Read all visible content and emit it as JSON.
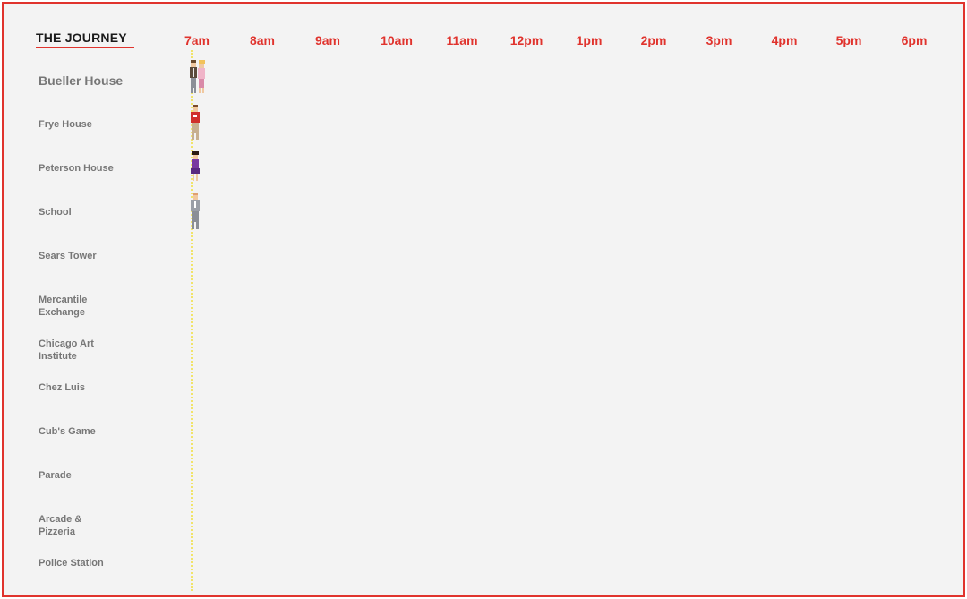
{
  "title": "THE JOURNEY",
  "hours": [
    "7am",
    "8am",
    "9am",
    "10am",
    "11am",
    "12pm",
    "1pm",
    "2pm",
    "3pm",
    "4pm",
    "5pm",
    "6pm"
  ],
  "places": [
    {
      "line1": "Bueller House",
      "line2": ""
    },
    {
      "line1": "Frye House",
      "line2": ""
    },
    {
      "line1": "Peterson House",
      "line2": ""
    },
    {
      "line1": "School",
      "line2": ""
    },
    {
      "line1": "Sears Tower",
      "line2": ""
    },
    {
      "line1": "Mercantile",
      "line2": "Exchange"
    },
    {
      "line1": "Chicago Art",
      "line2": "Institute"
    },
    {
      "line1": "Chez Luis",
      "line2": ""
    },
    {
      "line1": "Cub's Game",
      "line2": ""
    },
    {
      "line1": "Parade",
      "line2": ""
    },
    {
      "line1": "Arcade &",
      "line2": "Pizzeria"
    },
    {
      "line1": "Police Station",
      "line2": ""
    }
  ],
  "characters": [
    {
      "icon": "pixel-character-pair-icon",
      "place": "Bueller House"
    },
    {
      "icon": "pixel-character-red-shirt-icon",
      "place": "Frye House"
    },
    {
      "icon": "pixel-character-purple-dress-icon",
      "place": "Peterson House"
    },
    {
      "icon": "pixel-character-grey-suit-icon",
      "place": "School"
    }
  ],
  "colors": {
    "accent": "#e0332d",
    "timeline": "#f1e46a",
    "label": "#777777",
    "background": "#f3f3f3"
  }
}
